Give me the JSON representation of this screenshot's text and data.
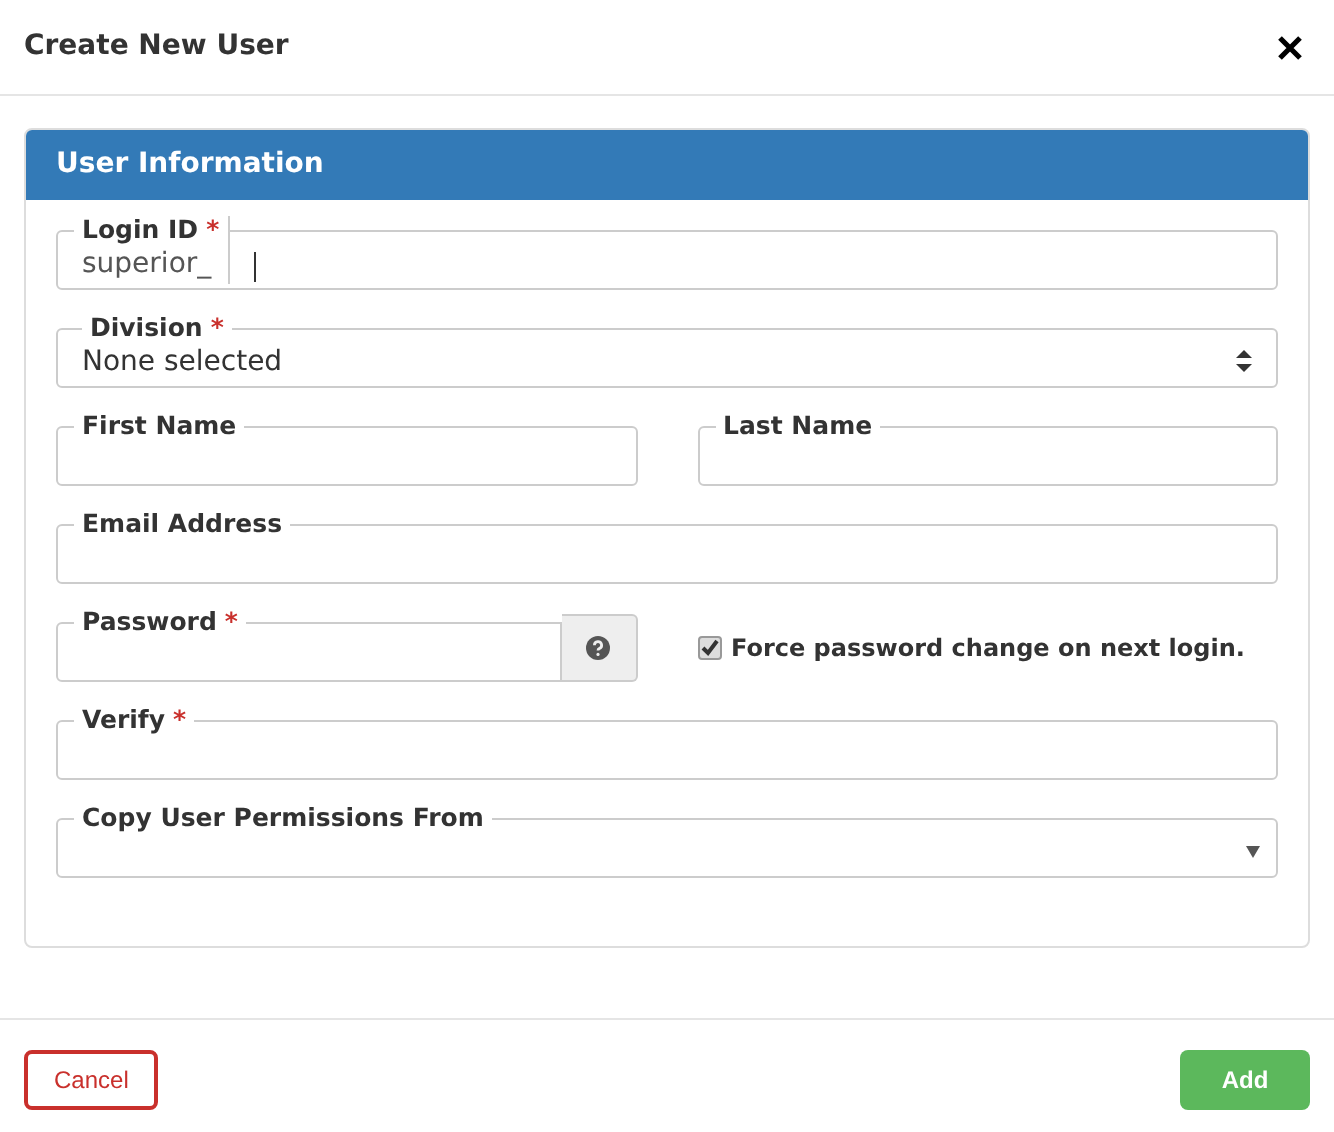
{
  "dialog": {
    "title": "Create New User"
  },
  "panel": {
    "title": "User Information"
  },
  "rows": [
    [
      {
        "kind": "prefixed",
        "label": "Login ID",
        "required_mark": "*",
        "prefix": "superior_",
        "focused": true
      }
    ],
    [
      {
        "kind": "select",
        "label": "Division",
        "required_mark": "*",
        "value": "None selected"
      }
    ],
    [
      {
        "kind": "text",
        "label": "First Name"
      },
      {
        "kind": "text",
        "label": "Last Name"
      }
    ],
    [
      {
        "kind": "text",
        "label": "Email Address"
      }
    ],
    [
      {
        "kind": "password",
        "label": "Password",
        "required_mark": "*"
      },
      {
        "kind": "checkbox",
        "label": "Force password change on next login.",
        "checked": true
      }
    ],
    [
      {
        "kind": "text",
        "label": "Verify",
        "required_mark": "*"
      }
    ],
    [
      {
        "kind": "dropdown",
        "label": "Copy User Permissions From"
      }
    ]
  ],
  "buttons": [
    {
      "kind": "cancel",
      "label": "Cancel"
    },
    {
      "kind": "primary",
      "label": "Add"
    }
  ]
}
